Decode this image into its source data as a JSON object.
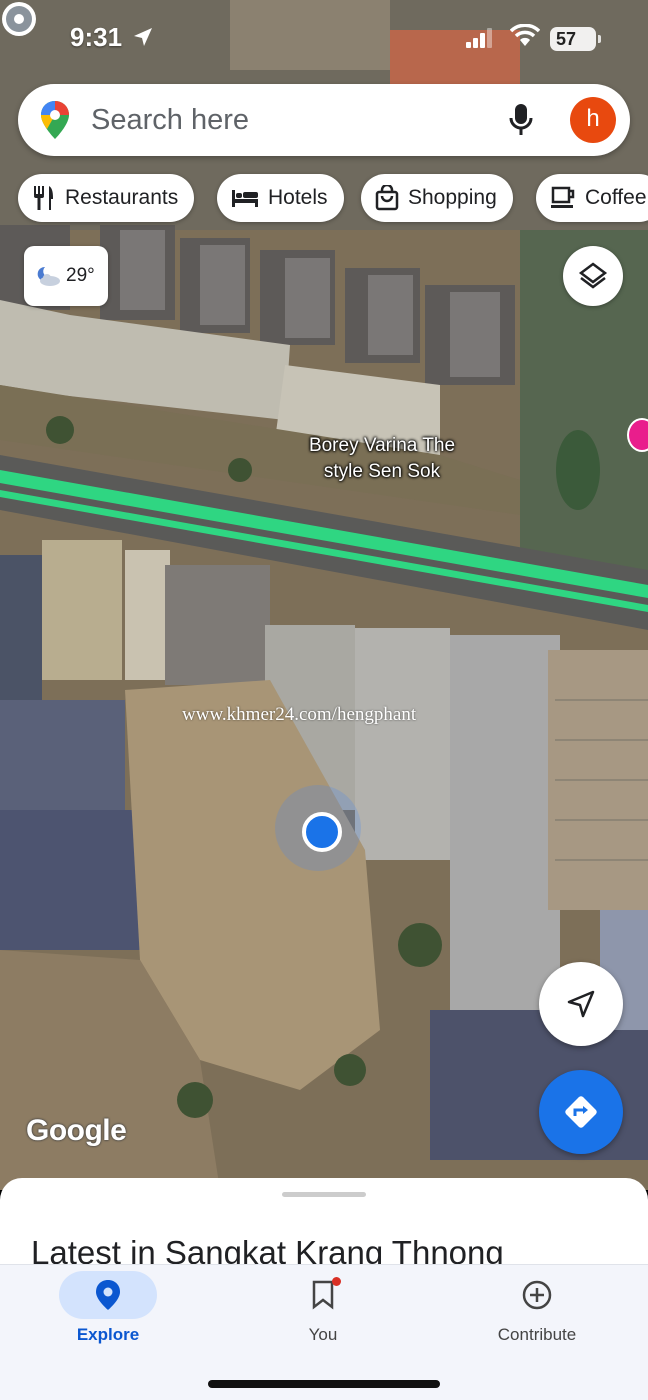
{
  "status_bar": {
    "time": "9:31",
    "battery": "57",
    "battery_level": 0.57
  },
  "search": {
    "placeholder": "Search here",
    "avatar_letter": "h"
  },
  "chips": [
    {
      "label": "Restaurants",
      "icon": "fork-knife-icon"
    },
    {
      "label": "Hotels",
      "icon": "bed-icon"
    },
    {
      "label": "Shopping",
      "icon": "shopping-bag-icon"
    },
    {
      "label": "Coffee",
      "icon": "coffee-cup-icon"
    }
  ],
  "weather": {
    "temperature": "29°",
    "icon": "partly-cloudy-night-icon"
  },
  "map": {
    "place_label_line1": "Borey Varina The",
    "place_label_line2": "style Sen Sok",
    "watermark": "www.khmer24.com/hengphant",
    "google_logo": "Google",
    "road_highlight_color": "#2fd682"
  },
  "bottom_sheet": {
    "title": "Latest in Sangkat Krang Thnong"
  },
  "bottom_nav": [
    {
      "label": "Explore",
      "icon": "location-pin-icon",
      "active": true
    },
    {
      "label": "You",
      "icon": "bookmark-icon",
      "active": false,
      "badge": true
    },
    {
      "label": "Contribute",
      "icon": "plus-circle-icon",
      "active": false
    }
  ],
  "colors": {
    "accent": "#1a73e8",
    "avatar": "#e8490f"
  }
}
